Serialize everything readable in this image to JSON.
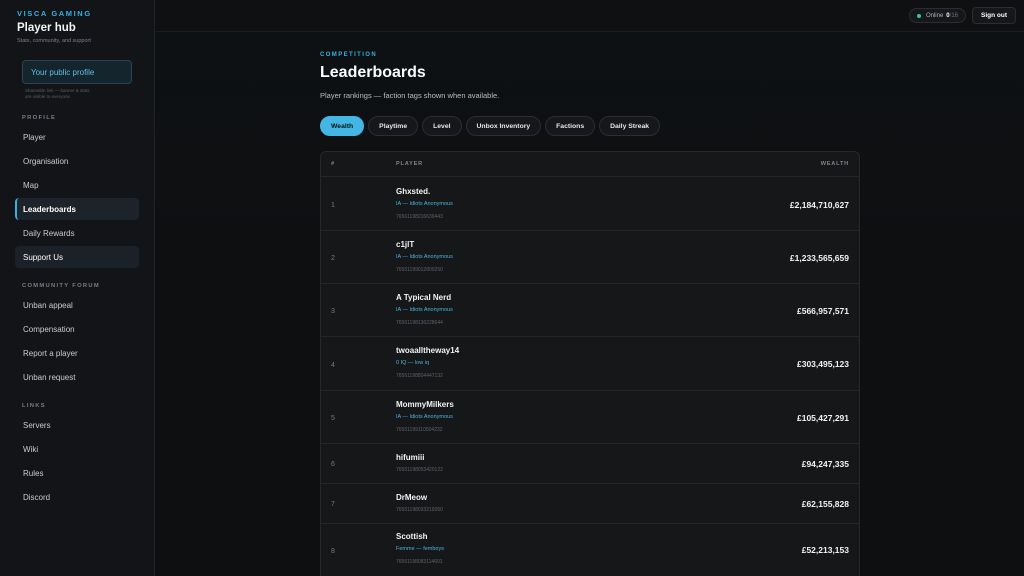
{
  "sidebar": {
    "brand": "VISCA GAMING",
    "title": "Player hub",
    "subtitle": "Stats, community, and support",
    "profile_button": "Your public profile",
    "profile_note": "Shareable link — banner & stats are visible to everyone",
    "sections": [
      {
        "label": "PROFILE",
        "items": [
          "Player",
          "Organisation",
          "Map",
          "Leaderboards",
          "Daily Rewards",
          "Support Us"
        ]
      },
      {
        "label": "COMMUNITY FORUM",
        "items": [
          "Unban appeal",
          "Compensation",
          "Report a player",
          "Unban request"
        ]
      },
      {
        "label": "LINKS",
        "items": [
          "Servers",
          "Wiki",
          "Rules",
          "Discord"
        ]
      }
    ]
  },
  "topbar": {
    "online_label": "Online",
    "online_count": "0",
    "online_sep": "/",
    "online_max": "16",
    "signout": "Sign out"
  },
  "page": {
    "eyebrow": "COMPETITION",
    "title": "Leaderboards",
    "subtitle": "Player rankings — faction tags shown when available."
  },
  "tabs": [
    "Wealth",
    "Playtime",
    "Level",
    "Unbox Inventory",
    "Factions",
    "Daily Streak"
  ],
  "table": {
    "headers": {
      "rank": "#",
      "player": "PLAYER",
      "wealth": "WEALTH"
    },
    "rows": [
      {
        "rank": "1",
        "name": "Ghxsted.",
        "faction": "IA — Idiots Anonymous",
        "id": "76561198216639443",
        "wealth": "£2,184,710,627"
      },
      {
        "rank": "2",
        "name": "c1jlT",
        "faction": "IA — Idiots Anonymous",
        "id": "76561199012800250",
        "wealth": "£1,233,565,659"
      },
      {
        "rank": "3",
        "name": "A Typical Nerd",
        "faction": "IA — Idiots Anonymous",
        "id": "76561198136228644",
        "wealth": "£566,957,571"
      },
      {
        "rank": "4",
        "name": "twoaalltheway14",
        "faction": "0 IQ — low iq",
        "id": "76561198804447132",
        "wealth": "£303,495,123"
      },
      {
        "rank": "5",
        "name": "MommyMilkers",
        "faction": "IA — Idiots Anonymous",
        "id": "76561199110504232",
        "wealth": "£105,427,291"
      },
      {
        "rank": "6",
        "name": "hifumiii",
        "faction": "",
        "id": "76561198053420122",
        "wealth": "£94,247,335"
      },
      {
        "rank": "7",
        "name": "DrMeow",
        "faction": "",
        "id": "76561198033219360",
        "wealth": "£62,155,828"
      },
      {
        "rank": "8",
        "name": "Scottish",
        "faction": "Femme — femboys",
        "id": "76561198083114601",
        "wealth": "£52,213,153"
      }
    ]
  },
  "colors": {
    "accent": "#43b6e4",
    "online": "#38c98a",
    "background": "#0d0e10"
  }
}
